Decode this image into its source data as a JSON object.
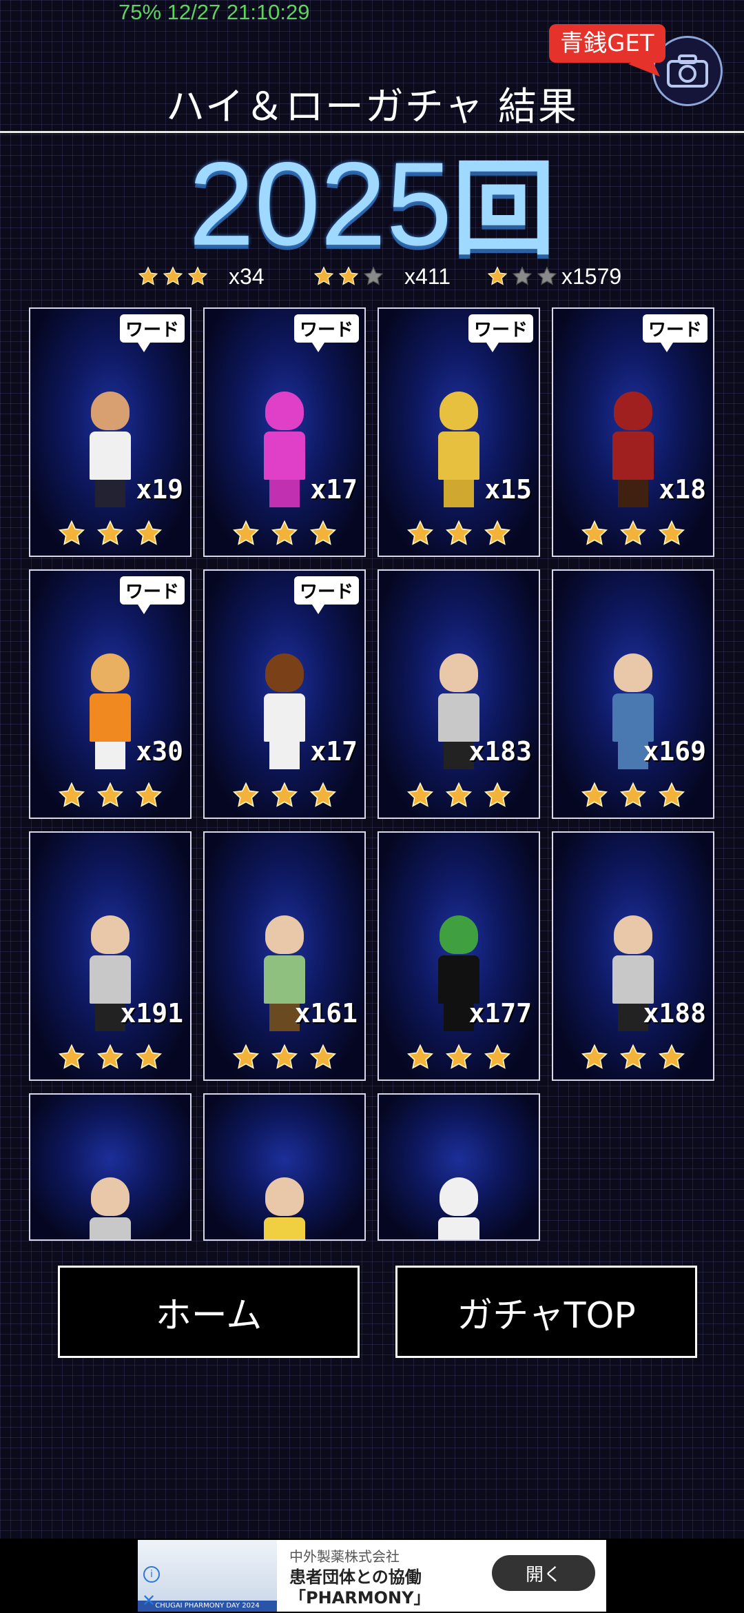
{
  "status": {
    "text": "75% 12/27 21:10:29"
  },
  "header": {
    "title": "ハイ＆ローガチャ 結果",
    "badge": "青銭GET"
  },
  "result": {
    "count": "2025",
    "unit": "回"
  },
  "summary": [
    {
      "filled": 3,
      "label": "x34"
    },
    {
      "filled": 2,
      "label": "x411"
    },
    {
      "filled": 1,
      "label": "x1579"
    }
  ],
  "word_tag": "ワード",
  "cards": [
    {
      "mult": "x19",
      "word": true
    },
    {
      "mult": "x17",
      "word": true
    },
    {
      "mult": "x15",
      "word": true
    },
    {
      "mult": "x18",
      "word": true
    },
    {
      "mult": "x30",
      "word": true
    },
    {
      "mult": "x17",
      "word": true
    },
    {
      "mult": "x183",
      "word": false
    },
    {
      "mult": "x169",
      "word": false
    },
    {
      "mult": "x191",
      "word": false
    },
    {
      "mult": "x161",
      "word": false
    },
    {
      "mult": "x177",
      "word": false
    },
    {
      "mult": "x188",
      "word": false
    }
  ],
  "buttons": {
    "home": "ホーム",
    "gacha_top": "ガチャTOP"
  },
  "ad": {
    "company": "中外製薬株式会社",
    "headline": "患者団体との協働",
    "subline": "「PHARMONY」",
    "open": "開く",
    "banner": "CHUGAI PHARMONY DAY 2024"
  },
  "colors": {
    "accent": "#9fd9ff",
    "badge": "#e5322b",
    "star": "#f3b23a",
    "status": "#5fd35f"
  }
}
